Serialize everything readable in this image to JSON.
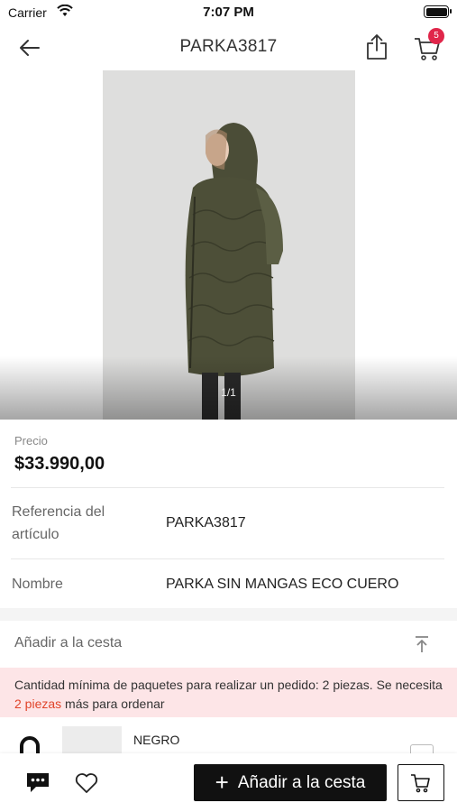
{
  "status_bar": {
    "carrier": "Carrier",
    "time": "7:07 PM"
  },
  "nav": {
    "title": "PARKA3817",
    "cart_count": "5"
  },
  "gallery": {
    "page_indicator": "1/1",
    "image": "product-photo"
  },
  "product": {
    "price_label": "Precio",
    "price_value": "$33.990,00",
    "reference_label_line1": "Referencia del",
    "reference_label_line2": "artículo",
    "reference_value": "PARKA3817",
    "name_label": "Nombre",
    "name_value": "PARKA SIN MANGAS ECO CUERO"
  },
  "add_section": {
    "title": "Añadir a la cesta",
    "notice_part1": "Cantidad mínima de paquetes para realizar un pedido: 2 piezas. Se necesita ",
    "notice_highlight": "2 piezas",
    "notice_part2": " más para ordenar",
    "highlight_color": "#e0442a"
  },
  "variant": {
    "name": "NEGRO"
  },
  "bottom_bar": {
    "add_to_cart_label": "Añadir a la cesta",
    "plus": "+"
  },
  "colors": {
    "accent": "#111111",
    "badge": "#e0264a",
    "notice_bg": "#fde5e7"
  },
  "icons": [
    "wifi-icon",
    "battery-icon",
    "back-arrow-icon",
    "share-icon",
    "cart-icon",
    "scroll-top-icon",
    "chat-icon",
    "heart-icon",
    "cart-outline-icon"
  ]
}
